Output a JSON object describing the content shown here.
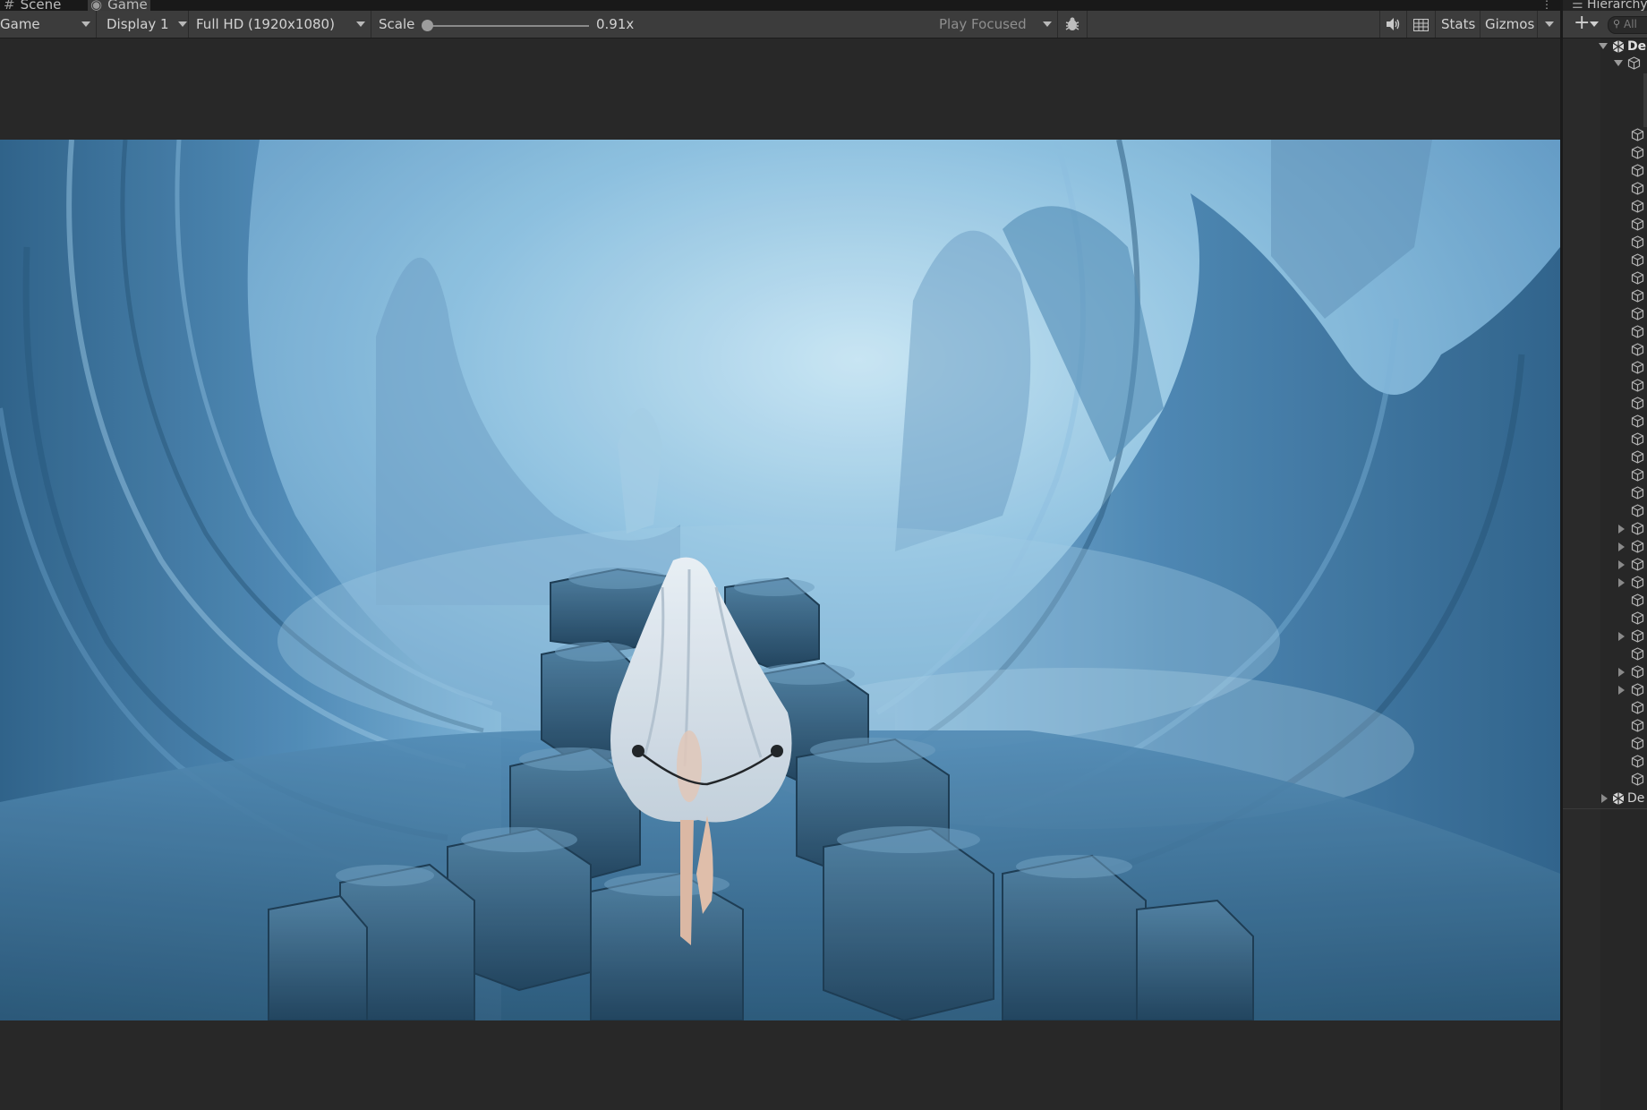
{
  "tabs": [
    {
      "label": "Scene",
      "icon": "grid-icon"
    },
    {
      "label": "Game",
      "icon": "gamepad-icon"
    }
  ],
  "toolbar": {
    "display_mode": "Game",
    "display": "Display 1",
    "resolution": "Full HD (1920x1080)",
    "scale_label": "Scale",
    "scale_value": "0.91x",
    "play_mode": "Play Focused",
    "stats": "Stats",
    "gizmos": "Gizmos"
  },
  "hierarchy": {
    "tab_label": "Hierarchy",
    "search_placeholder": "All",
    "scene1": "De",
    "scene2": "De"
  },
  "colors": {
    "editor_bg": "#282828",
    "toolbar_bg": "#3c3c3c",
    "fog_blue": "#6fa9cf",
    "rock_blue": "#2f6489"
  }
}
